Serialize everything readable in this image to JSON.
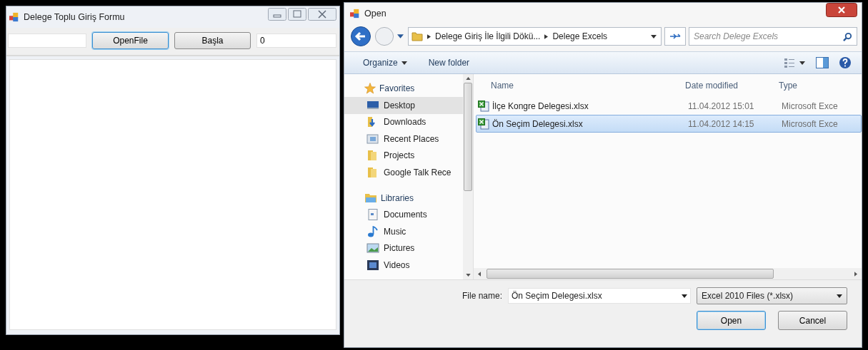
{
  "main_window": {
    "title": "Delege Toplu Giriş Formu",
    "buttons": [
      {
        "label": "OpenFile",
        "focused": true
      },
      {
        "label": "Başla",
        "focused": false
      }
    ],
    "count_field": {
      "value": "0"
    }
  },
  "dialog": {
    "title": "Open",
    "breadcrumb": [
      "Delege Giriş İle İlgili Dökü...",
      "Delege Excels"
    ],
    "search": {
      "placeholder": "Search Delege Excels"
    },
    "toolbar": [
      {
        "label": "Organize",
        "dropdown": true
      },
      {
        "label": "New folder",
        "dropdown": false
      }
    ],
    "nav": [
      {
        "label": "Favorites",
        "children": [
          {
            "label": "Desktop",
            "selected": true
          },
          {
            "label": "Downloads",
            "selected": false
          },
          {
            "label": "Recent Places",
            "selected": false
          },
          {
            "label": "Projects",
            "selected": false
          },
          {
            "label": "Google Talk Rece",
            "selected": false
          }
        ]
      },
      {
        "label": "Libraries",
        "children": [
          {
            "label": "Documents",
            "selected": false
          },
          {
            "label": "Music",
            "selected": false
          },
          {
            "label": "Pictures",
            "selected": false
          },
          {
            "label": "Videos",
            "selected": false
          }
        ]
      }
    ],
    "columns": [
      "Name",
      "Date modified",
      "Type"
    ],
    "files": [
      {
        "name": "İlçe Kongre Delegesi.xlsx",
        "date": "11.04.2012 15:01",
        "type": "Microsoft Exce",
        "selected": false
      },
      {
        "name": "Ön Seçim Delegesi.xlsx",
        "date": "11.04.2012 14:15",
        "type": "Microsoft Exce",
        "selected": true
      }
    ],
    "file_name_label": "File name:",
    "file_name": {
      "value": "Ön Seçim Delegesi.xlsx"
    },
    "filter": {
      "value": "Excel 2010 Files (*.xlsx)"
    },
    "buttons": [
      {
        "label": "Open",
        "focused": true
      },
      {
        "label": "Cancel",
        "focused": false
      }
    ]
  }
}
